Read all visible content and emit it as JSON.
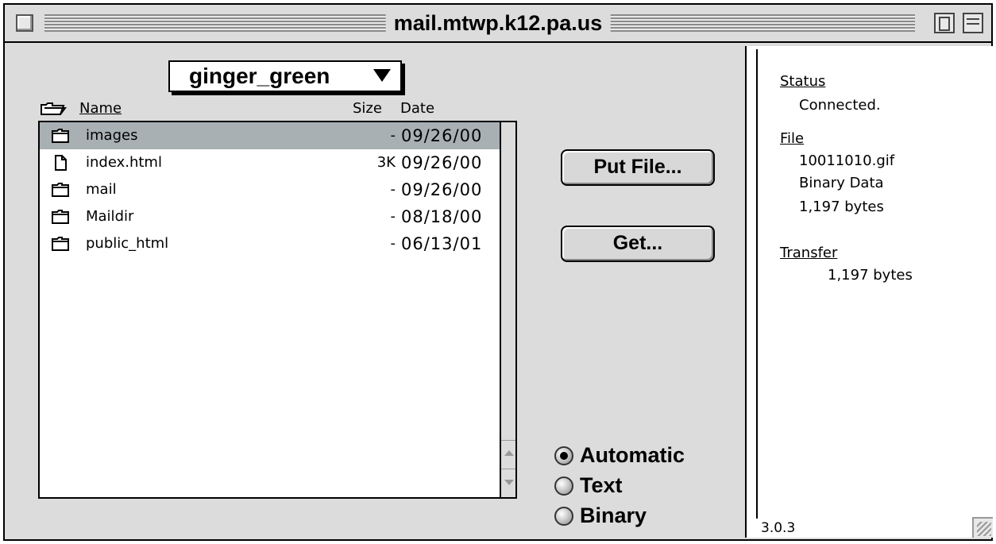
{
  "window": {
    "title": "mail.mtwp.k12.pa.us"
  },
  "directory": {
    "current": "ginger_green"
  },
  "columns": {
    "name": "Name",
    "size": "Size",
    "date": "Date"
  },
  "files": [
    {
      "icon": "folder-icon",
      "name": "images",
      "size": "-",
      "date": "09/26/00",
      "selected": true
    },
    {
      "icon": "document-icon",
      "name": "index.html",
      "size": "3K",
      "date": "09/26/00",
      "selected": false
    },
    {
      "icon": "folder-icon",
      "name": "mail",
      "size": "-",
      "date": "09/26/00",
      "selected": false
    },
    {
      "icon": "folder-icon",
      "name": "Maildir",
      "size": "-",
      "date": "08/18/00",
      "selected": false
    },
    {
      "icon": "folder-icon",
      "name": "public_html",
      "size": "-",
      "date": "06/13/01",
      "selected": false
    }
  ],
  "buttons": {
    "put": "Put File...",
    "get": "Get..."
  },
  "transfer_mode": {
    "options": [
      "Automatic",
      "Text",
      "Binary"
    ],
    "selected": "Automatic"
  },
  "info": {
    "status_label": "Status",
    "status_value": "Connected.",
    "file_label": "File",
    "file_name": "10011010.gif",
    "file_type": "Binary Data",
    "file_size": "1,197 bytes",
    "transfer_label": "Transfer",
    "transfer_value": "1,197 bytes"
  },
  "version": "3.0.3",
  "colors": {
    "selection": "#a8b0b4",
    "chrome": "#dcdcdc"
  }
}
